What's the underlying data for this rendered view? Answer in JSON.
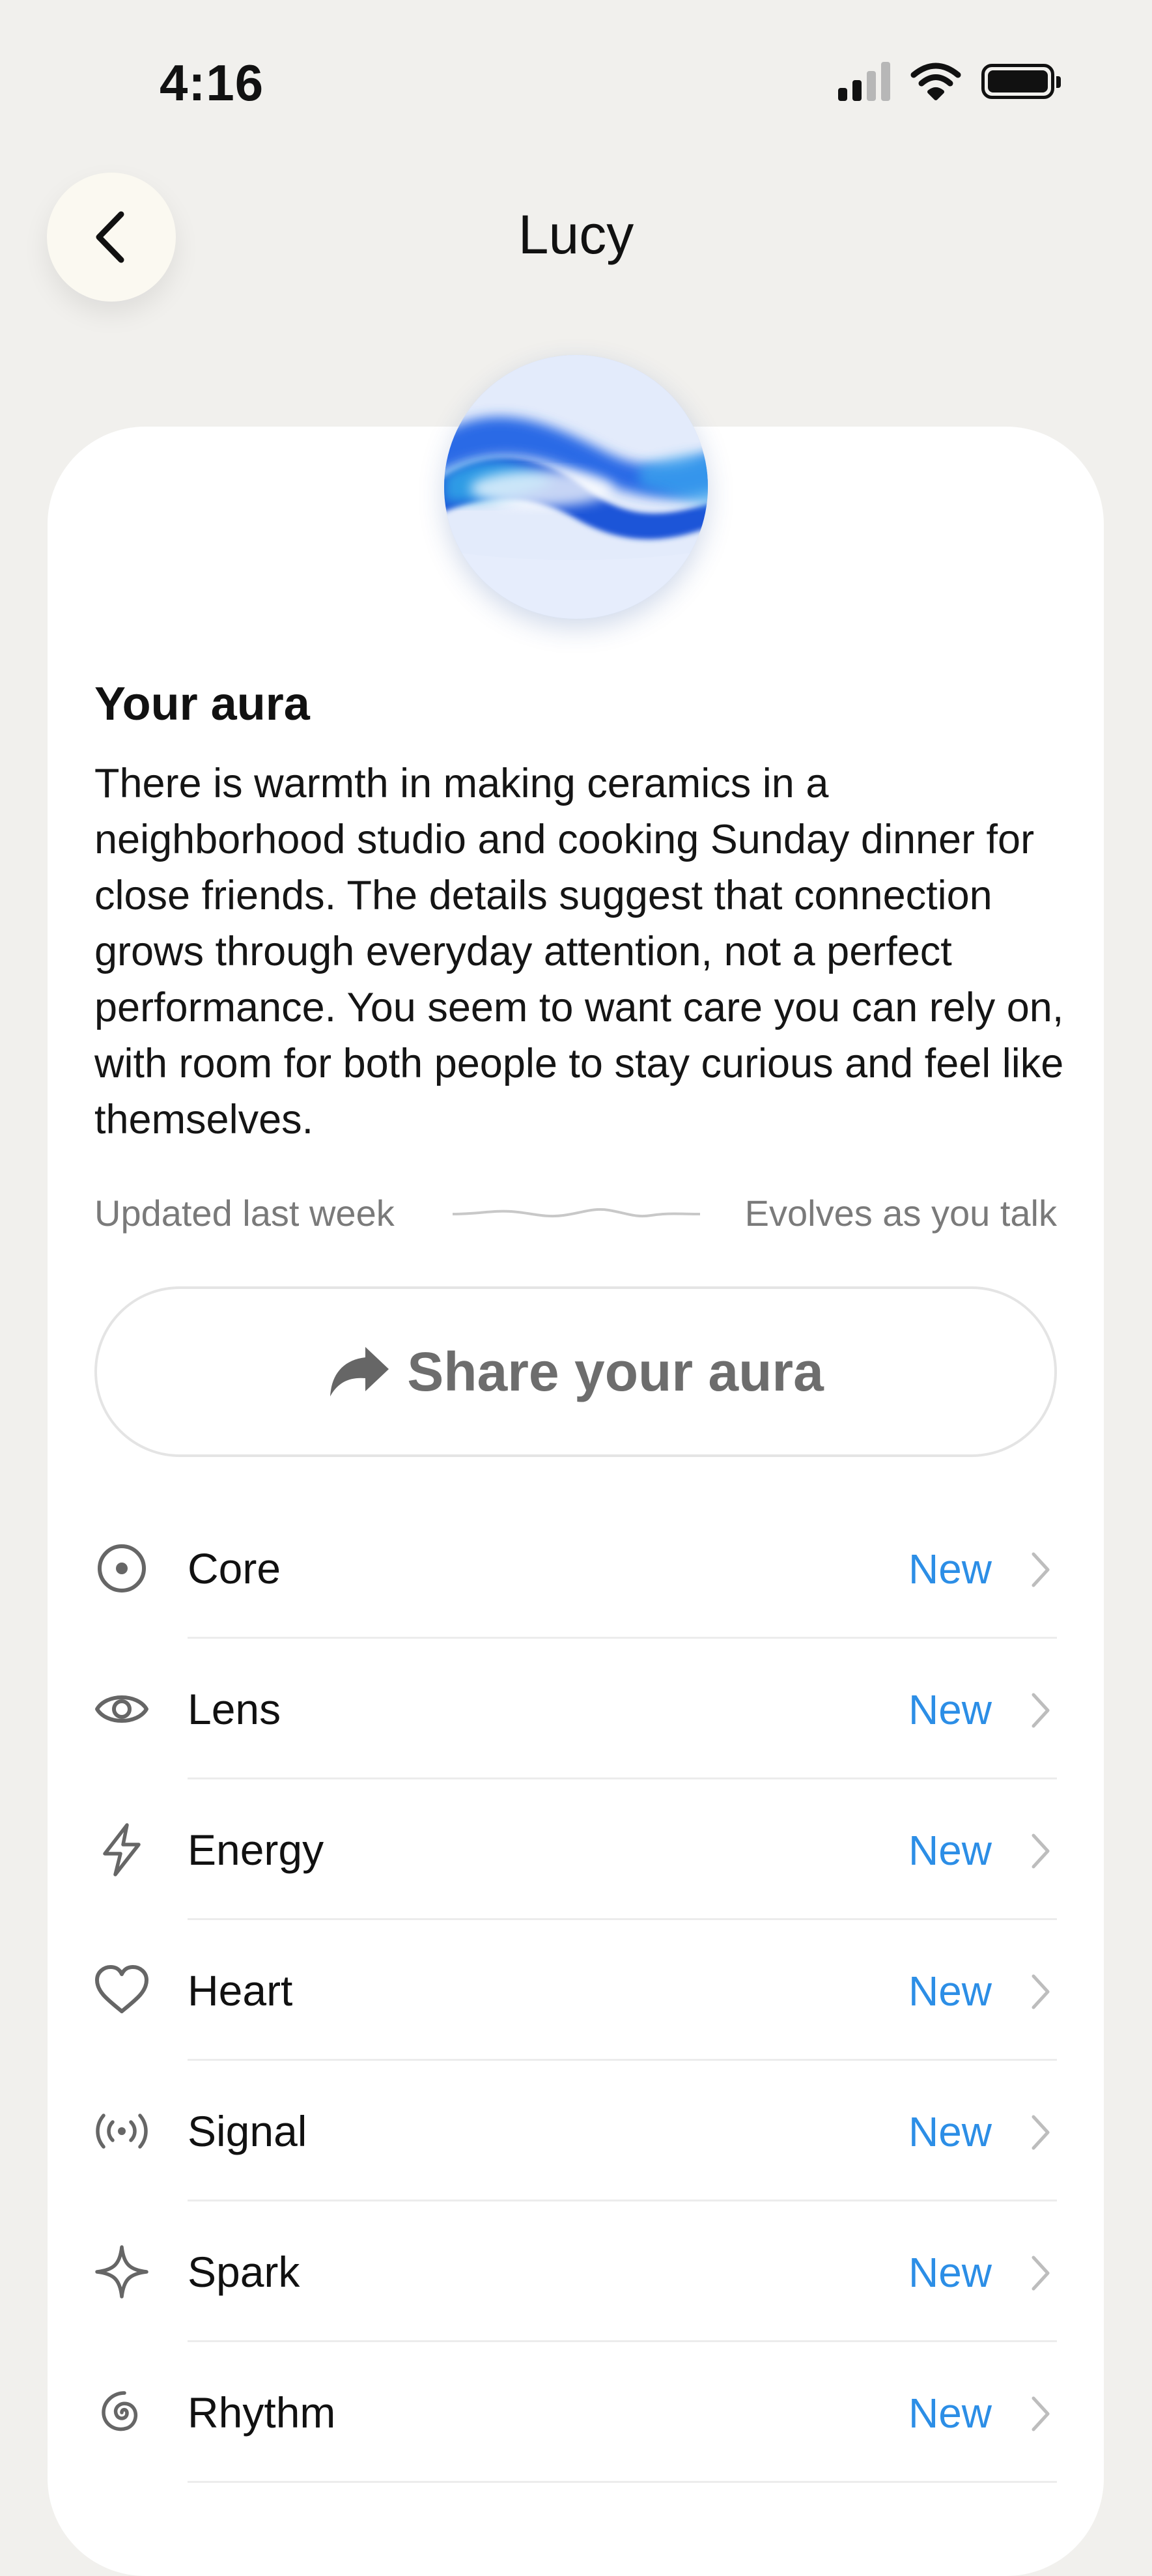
{
  "status_bar": {
    "time": "4:16"
  },
  "header": {
    "title": "Lucy"
  },
  "aura": {
    "heading": "Your aura",
    "description": "There is warmth in making ceramics in a neighborhood studio and cooking Sunday dinner for close friends. The details suggest that connection grows through everyday attention, not a perfect performance. You seem to want care you can rely on, with room for both people to stay curious and feel like themselves.",
    "updated": "Updated last week",
    "evolves": "Evolves as you talk",
    "share_label": "Share your aura"
  },
  "colors": {
    "badge": "#2c8ee6",
    "orb_blue": "#1f55d8",
    "background": "#f1f0ed"
  },
  "list": {
    "items": [
      {
        "label": "Core",
        "icon": "target-icon",
        "badge": "New"
      },
      {
        "label": "Lens",
        "icon": "eye-icon",
        "badge": "New"
      },
      {
        "label": "Energy",
        "icon": "lightning-icon",
        "badge": "New"
      },
      {
        "label": "Heart",
        "icon": "heart-icon",
        "badge": "New"
      },
      {
        "label": "Signal",
        "icon": "signal-waves-icon",
        "badge": "New"
      },
      {
        "label": "Spark",
        "icon": "sparkle-icon",
        "badge": "New"
      },
      {
        "label": "Rhythm",
        "icon": "spiral-icon",
        "badge": "New"
      }
    ]
  }
}
